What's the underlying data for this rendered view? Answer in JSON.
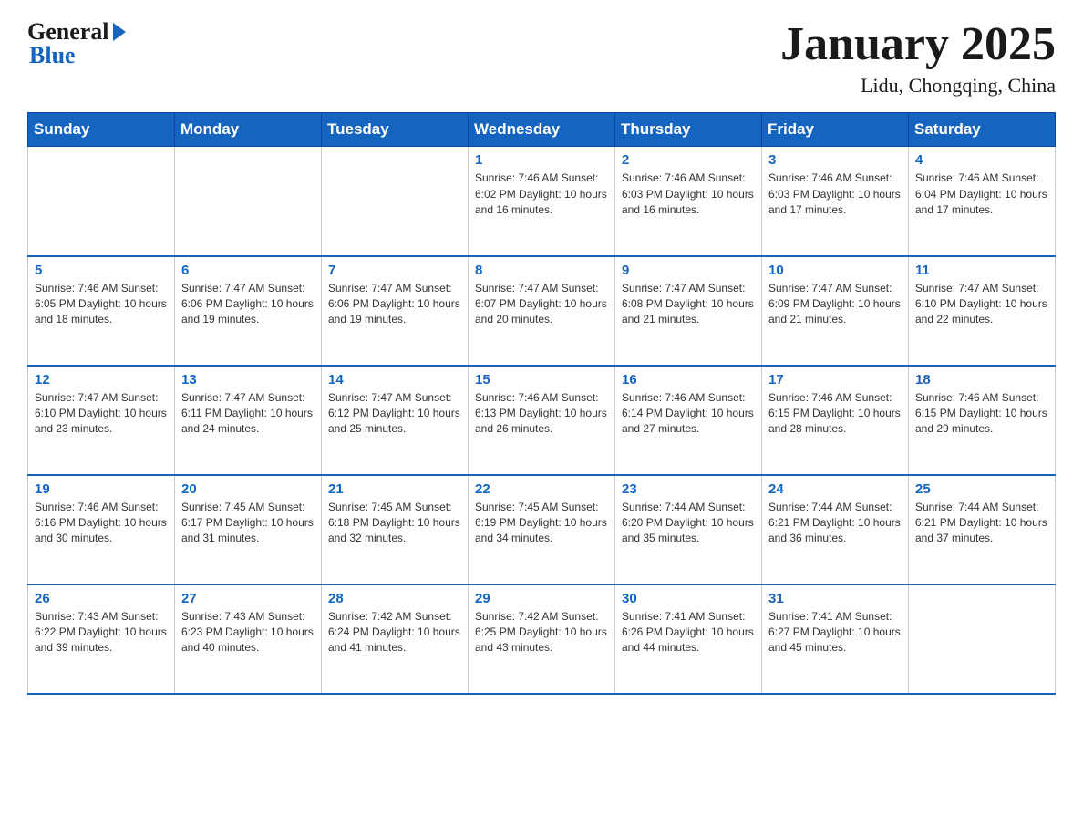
{
  "header": {
    "logo_text": "General",
    "logo_blue": "Blue",
    "month_title": "January 2025",
    "location": "Lidu, Chongqing, China"
  },
  "days_of_week": [
    "Sunday",
    "Monday",
    "Tuesday",
    "Wednesday",
    "Thursday",
    "Friday",
    "Saturday"
  ],
  "weeks": [
    [
      {
        "day": "",
        "info": ""
      },
      {
        "day": "",
        "info": ""
      },
      {
        "day": "",
        "info": ""
      },
      {
        "day": "1",
        "info": "Sunrise: 7:46 AM\nSunset: 6:02 PM\nDaylight: 10 hours\nand 16 minutes."
      },
      {
        "day": "2",
        "info": "Sunrise: 7:46 AM\nSunset: 6:03 PM\nDaylight: 10 hours\nand 16 minutes."
      },
      {
        "day": "3",
        "info": "Sunrise: 7:46 AM\nSunset: 6:03 PM\nDaylight: 10 hours\nand 17 minutes."
      },
      {
        "day": "4",
        "info": "Sunrise: 7:46 AM\nSunset: 6:04 PM\nDaylight: 10 hours\nand 17 minutes."
      }
    ],
    [
      {
        "day": "5",
        "info": "Sunrise: 7:46 AM\nSunset: 6:05 PM\nDaylight: 10 hours\nand 18 minutes."
      },
      {
        "day": "6",
        "info": "Sunrise: 7:47 AM\nSunset: 6:06 PM\nDaylight: 10 hours\nand 19 minutes."
      },
      {
        "day": "7",
        "info": "Sunrise: 7:47 AM\nSunset: 6:06 PM\nDaylight: 10 hours\nand 19 minutes."
      },
      {
        "day": "8",
        "info": "Sunrise: 7:47 AM\nSunset: 6:07 PM\nDaylight: 10 hours\nand 20 minutes."
      },
      {
        "day": "9",
        "info": "Sunrise: 7:47 AM\nSunset: 6:08 PM\nDaylight: 10 hours\nand 21 minutes."
      },
      {
        "day": "10",
        "info": "Sunrise: 7:47 AM\nSunset: 6:09 PM\nDaylight: 10 hours\nand 21 minutes."
      },
      {
        "day": "11",
        "info": "Sunrise: 7:47 AM\nSunset: 6:10 PM\nDaylight: 10 hours\nand 22 minutes."
      }
    ],
    [
      {
        "day": "12",
        "info": "Sunrise: 7:47 AM\nSunset: 6:10 PM\nDaylight: 10 hours\nand 23 minutes."
      },
      {
        "day": "13",
        "info": "Sunrise: 7:47 AM\nSunset: 6:11 PM\nDaylight: 10 hours\nand 24 minutes."
      },
      {
        "day": "14",
        "info": "Sunrise: 7:47 AM\nSunset: 6:12 PM\nDaylight: 10 hours\nand 25 minutes."
      },
      {
        "day": "15",
        "info": "Sunrise: 7:46 AM\nSunset: 6:13 PM\nDaylight: 10 hours\nand 26 minutes."
      },
      {
        "day": "16",
        "info": "Sunrise: 7:46 AM\nSunset: 6:14 PM\nDaylight: 10 hours\nand 27 minutes."
      },
      {
        "day": "17",
        "info": "Sunrise: 7:46 AM\nSunset: 6:15 PM\nDaylight: 10 hours\nand 28 minutes."
      },
      {
        "day": "18",
        "info": "Sunrise: 7:46 AM\nSunset: 6:15 PM\nDaylight: 10 hours\nand 29 minutes."
      }
    ],
    [
      {
        "day": "19",
        "info": "Sunrise: 7:46 AM\nSunset: 6:16 PM\nDaylight: 10 hours\nand 30 minutes."
      },
      {
        "day": "20",
        "info": "Sunrise: 7:45 AM\nSunset: 6:17 PM\nDaylight: 10 hours\nand 31 minutes."
      },
      {
        "day": "21",
        "info": "Sunrise: 7:45 AM\nSunset: 6:18 PM\nDaylight: 10 hours\nand 32 minutes."
      },
      {
        "day": "22",
        "info": "Sunrise: 7:45 AM\nSunset: 6:19 PM\nDaylight: 10 hours\nand 34 minutes."
      },
      {
        "day": "23",
        "info": "Sunrise: 7:44 AM\nSunset: 6:20 PM\nDaylight: 10 hours\nand 35 minutes."
      },
      {
        "day": "24",
        "info": "Sunrise: 7:44 AM\nSunset: 6:21 PM\nDaylight: 10 hours\nand 36 minutes."
      },
      {
        "day": "25",
        "info": "Sunrise: 7:44 AM\nSunset: 6:21 PM\nDaylight: 10 hours\nand 37 minutes."
      }
    ],
    [
      {
        "day": "26",
        "info": "Sunrise: 7:43 AM\nSunset: 6:22 PM\nDaylight: 10 hours\nand 39 minutes."
      },
      {
        "day": "27",
        "info": "Sunrise: 7:43 AM\nSunset: 6:23 PM\nDaylight: 10 hours\nand 40 minutes."
      },
      {
        "day": "28",
        "info": "Sunrise: 7:42 AM\nSunset: 6:24 PM\nDaylight: 10 hours\nand 41 minutes."
      },
      {
        "day": "29",
        "info": "Sunrise: 7:42 AM\nSunset: 6:25 PM\nDaylight: 10 hours\nand 43 minutes."
      },
      {
        "day": "30",
        "info": "Sunrise: 7:41 AM\nSunset: 6:26 PM\nDaylight: 10 hours\nand 44 minutes."
      },
      {
        "day": "31",
        "info": "Sunrise: 7:41 AM\nSunset: 6:27 PM\nDaylight: 10 hours\nand 45 minutes."
      },
      {
        "day": "",
        "info": ""
      }
    ]
  ]
}
